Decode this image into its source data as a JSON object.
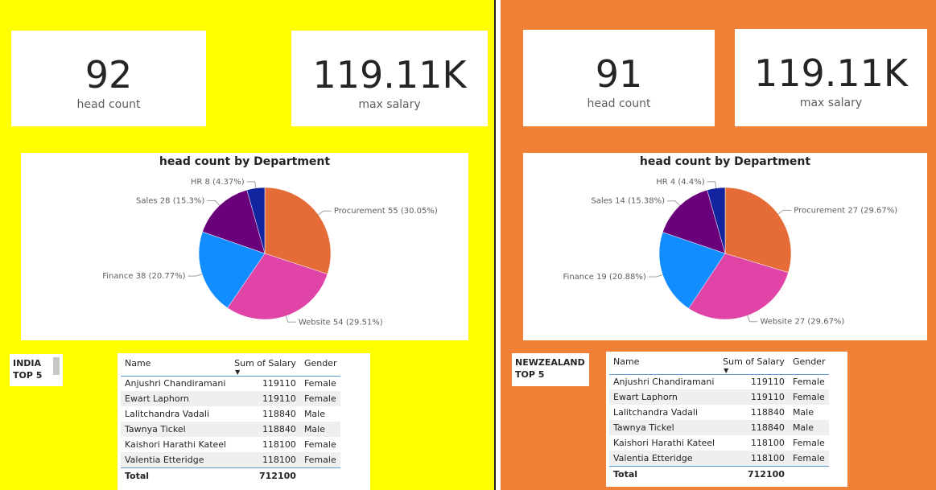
{
  "panels": [
    {
      "id": "india",
      "background": "#ffff00",
      "head_count": {
        "value": "92",
        "label": "head count"
      },
      "max_salary": {
        "value": "119.11K",
        "label": "max salary"
      },
      "tag": {
        "line1": "INDIA",
        "line2": "TOP 5"
      },
      "table": {
        "columns": [
          "Name",
          "Sum of Salary",
          "Gender"
        ],
        "rows": [
          [
            "Anjushri Chandiramani",
            "119110",
            "Female"
          ],
          [
            "Ewart Laphorn",
            "119110",
            "Female"
          ],
          [
            "Lalitchandra Vadali",
            "118840",
            "Male"
          ],
          [
            "Tawnya Tickel",
            "118840",
            "Male"
          ],
          [
            "Kaishori Harathi Kateel",
            "118100",
            "Female"
          ],
          [
            "Valentia Etteridge",
            "118100",
            "Female"
          ]
        ],
        "total_label": "Total",
        "total_value": "712100"
      }
    },
    {
      "id": "newzealand",
      "background": "#f08036",
      "head_count": {
        "value": "91",
        "label": "head count"
      },
      "max_salary": {
        "value": "119.11K",
        "label": "max salary"
      },
      "tag": {
        "line1": "NEWZEALAND",
        "line2": "TOP 5"
      },
      "table": {
        "columns": [
          "Name",
          "Sum of Salary",
          "Gender"
        ],
        "rows": [
          [
            "Anjushri Chandiramani",
            "119110",
            "Female"
          ],
          [
            "Ewart Laphorn",
            "119110",
            "Female"
          ],
          [
            "Lalitchandra Vadali",
            "118840",
            "Male"
          ],
          [
            "Tawnya Tickel",
            "118840",
            "Male"
          ],
          [
            "Kaishori Harathi Kateel",
            "118100",
            "Female"
          ],
          [
            "Valentia Etteridge",
            "118100",
            "Female"
          ]
        ],
        "total_label": "Total",
        "total_value": "712100"
      }
    }
  ],
  "chart_data": [
    {
      "type": "pie",
      "title": "head count by Department",
      "slices": [
        {
          "name": "Procurement",
          "value": 55,
          "label": "Procurement 55 (30.05%)",
          "color": "#e66c37"
        },
        {
          "name": "Website",
          "value": 54,
          "label": "Website 54 (29.51%)",
          "color": "#e044a7"
        },
        {
          "name": "Finance",
          "value": 38,
          "label": "Finance 38 (20.77%)",
          "color": "#118dff"
        },
        {
          "name": "Sales",
          "value": 28,
          "label": "Sales 28 (15.3%)",
          "color": "#6b007b"
        },
        {
          "name": "HR",
          "value": 8,
          "label": "HR 8 (4.37%)",
          "color": "#12239e"
        }
      ]
    },
    {
      "type": "pie",
      "title": "head count by Department",
      "slices": [
        {
          "name": "Procurement",
          "value": 27,
          "label": "Procurement 27 (29.67%)",
          "color": "#e66c37"
        },
        {
          "name": "Website",
          "value": 27,
          "label": "Website 27 (29.67%)",
          "color": "#e044a7"
        },
        {
          "name": "Finance",
          "value": 19,
          "label": "Finance 19 (20.88%)",
          "color": "#118dff"
        },
        {
          "name": "Sales",
          "value": 14,
          "label": "Sales 14 (15.38%)",
          "color": "#6b007b"
        },
        {
          "name": "HR",
          "value": 4,
          "label": "HR 4 (4.4%)",
          "color": "#12239e"
        }
      ]
    }
  ]
}
